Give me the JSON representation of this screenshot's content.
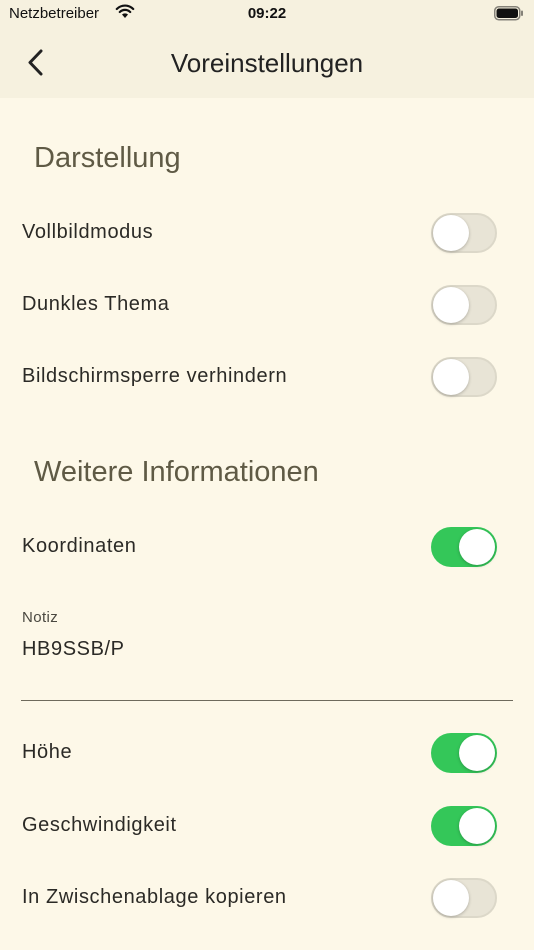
{
  "status_bar": {
    "carrier": "Netzbetreiber",
    "time": "09:22"
  },
  "nav": {
    "title": "Voreinstellungen"
  },
  "sections": {
    "display": {
      "title": "Darstellung",
      "fullscreen": {
        "label": "Vollbildmodus",
        "on": false
      },
      "dark_theme": {
        "label": "Dunkles Thema",
        "on": false
      },
      "prevent_lock": {
        "label": "Bildschirmsperre verhindern",
        "on": false
      }
    },
    "more_info": {
      "title": "Weitere Informationen",
      "coordinates": {
        "label": "Koordinaten",
        "on": true
      },
      "note": {
        "label": "Notiz",
        "value": "HB9SSB/P"
      },
      "altitude": {
        "label": "Höhe",
        "on": true
      },
      "speed": {
        "label": "Geschwindigkeit",
        "on": true
      },
      "clipboard": {
        "label": "In Zwischenablage kopieren",
        "on": false
      }
    }
  },
  "colors": {
    "background": "#fdf8e8",
    "bar": "#f6f1df",
    "toggle_on": "#34c759",
    "toggle_off": "#e8e4d6",
    "section_title": "#5f5a45"
  }
}
